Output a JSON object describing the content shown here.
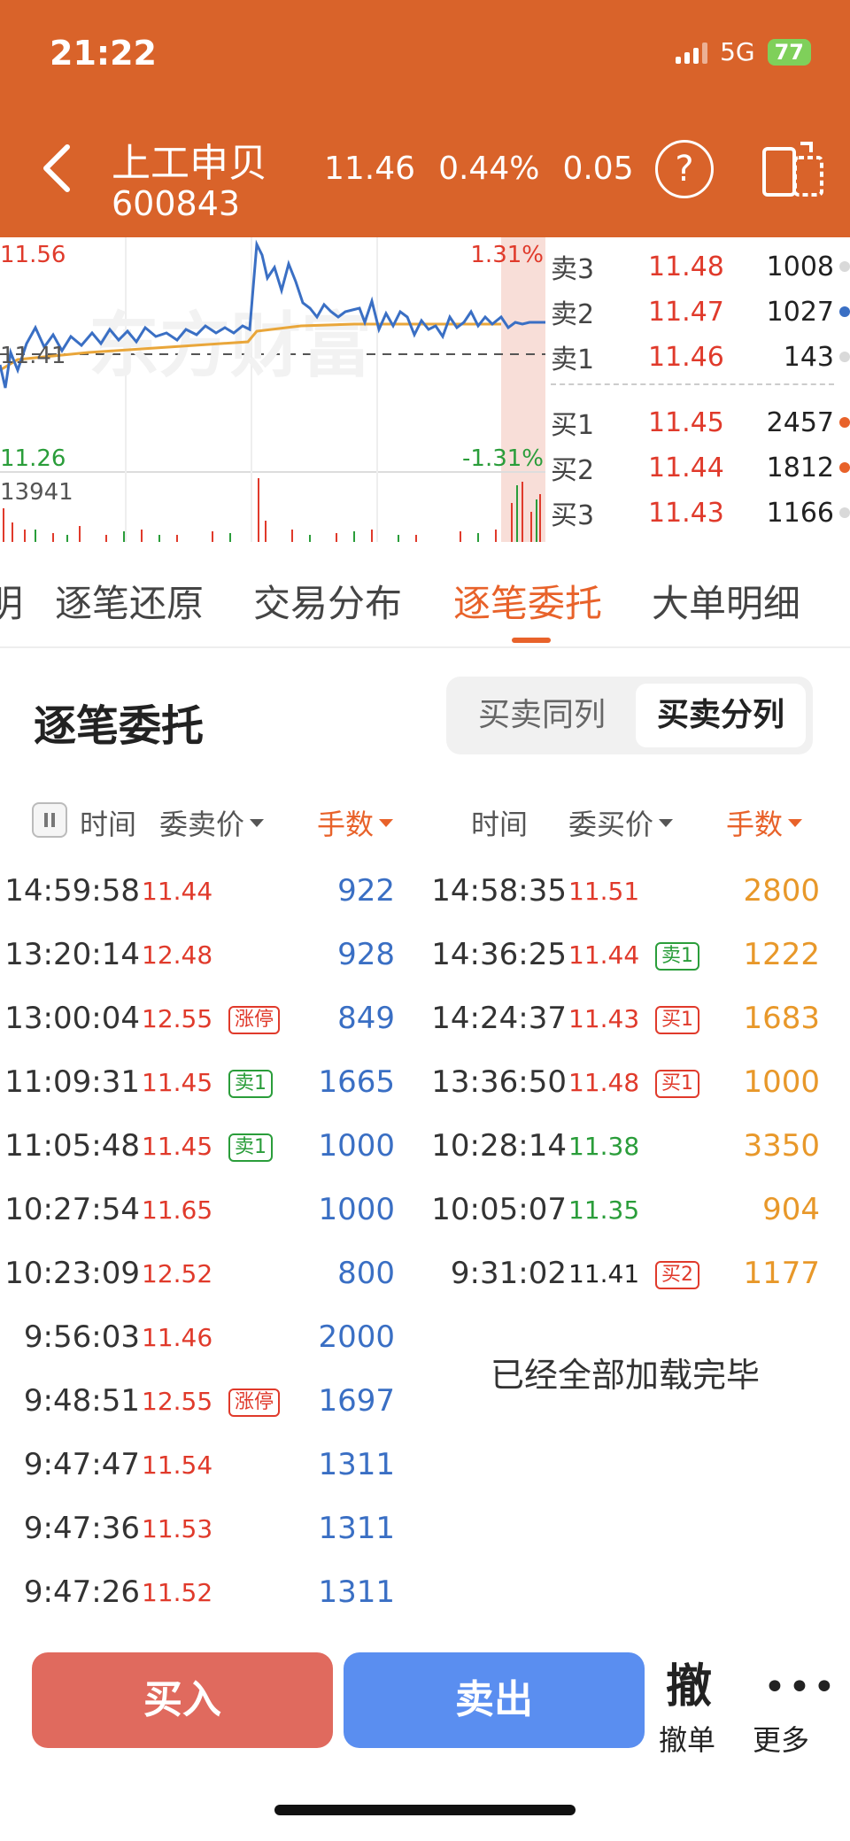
{
  "status": {
    "time": "21:22",
    "network": "5G",
    "battery": "77"
  },
  "header": {
    "name": "上工申贝",
    "code": "600843",
    "price": "11.46",
    "change_pct": "0.44%",
    "change": "0.05",
    "help": "?"
  },
  "chart": {
    "high": "11.56",
    "low": "11.26",
    "mid": "11.41",
    "high_pct": "1.31%",
    "low_pct": "-1.31%",
    "volume": "13941",
    "watermark": "东方财富"
  },
  "depth": {
    "sell": [
      {
        "label": "卖3",
        "price": "11.48",
        "vol": "1008",
        "dot": "#d9d9d9"
      },
      {
        "label": "卖2",
        "price": "11.47",
        "vol": "1027",
        "dot": "#3a6fc4"
      },
      {
        "label": "卖1",
        "price": "11.46",
        "vol": "143",
        "dot": "#d9d9d9"
      }
    ],
    "buy": [
      {
        "label": "买1",
        "price": "11.45",
        "vol": "2457",
        "dot": "#e8622a"
      },
      {
        "label": "买2",
        "price": "11.44",
        "vol": "1812",
        "dot": "#e8622a"
      },
      {
        "label": "买3",
        "price": "11.43",
        "vol": "1166",
        "dot": "#d9d9d9"
      }
    ]
  },
  "tabs": [
    "明",
    "逐笔还原",
    "交易分布",
    "逐笔委托",
    "大单明细"
  ],
  "section": {
    "title": "逐笔委托",
    "seg_same": "买卖同列",
    "seg_split": "买卖分列"
  },
  "columns": {
    "left": {
      "time": "时间",
      "price": "委卖价",
      "qty": "手数"
    },
    "right": {
      "time": "时间",
      "price": "委买价",
      "qty": "手数"
    }
  },
  "left_rows": [
    {
      "time": "14:59:58",
      "price": "11.44",
      "pc": "red",
      "badge": "",
      "bc": "",
      "qty": "922"
    },
    {
      "time": "13:20:14",
      "price": "12.48",
      "pc": "red",
      "badge": "",
      "bc": "",
      "qty": "928"
    },
    {
      "time": "13:00:04",
      "price": "12.55",
      "pc": "red",
      "badge": "涨停",
      "bc": "red",
      "qty": "849"
    },
    {
      "time": "11:09:31",
      "price": "11.45",
      "pc": "red",
      "badge": "卖1",
      "bc": "green",
      "qty": "1665"
    },
    {
      "time": "11:05:48",
      "price": "11.45",
      "pc": "red",
      "badge": "卖1",
      "bc": "green",
      "qty": "1000"
    },
    {
      "time": "10:27:54",
      "price": "11.65",
      "pc": "red",
      "badge": "",
      "bc": "",
      "qty": "1000"
    },
    {
      "time": "10:23:09",
      "price": "12.52",
      "pc": "red",
      "badge": "",
      "bc": "",
      "qty": "800"
    },
    {
      "time": "9:56:03",
      "price": "11.46",
      "pc": "red",
      "badge": "",
      "bc": "",
      "qty": "2000"
    },
    {
      "time": "9:48:51",
      "price": "12.55",
      "pc": "red",
      "badge": "涨停",
      "bc": "red",
      "qty": "1697"
    },
    {
      "time": "9:47:47",
      "price": "11.54",
      "pc": "red",
      "badge": "",
      "bc": "",
      "qty": "1311"
    },
    {
      "time": "9:47:36",
      "price": "11.53",
      "pc": "red",
      "badge": "",
      "bc": "",
      "qty": "1311"
    },
    {
      "time": "9:47:26",
      "price": "11.52",
      "pc": "red",
      "badge": "",
      "bc": "",
      "qty": "1311"
    }
  ],
  "right_rows": [
    {
      "time": "14:58:35",
      "price": "11.51",
      "pc": "red",
      "badge": "",
      "bc": "",
      "qty": "2800"
    },
    {
      "time": "14:36:25",
      "price": "11.44",
      "pc": "red",
      "badge": "卖1",
      "bc": "green",
      "qty": "1222"
    },
    {
      "time": "14:24:37",
      "price": "11.43",
      "pc": "red",
      "badge": "买1",
      "bc": "red",
      "qty": "1683"
    },
    {
      "time": "13:36:50",
      "price": "11.48",
      "pc": "red",
      "badge": "买1",
      "bc": "red",
      "qty": "1000"
    },
    {
      "time": "10:28:14",
      "price": "11.38",
      "pc": "green",
      "badge": "",
      "bc": "",
      "qty": "3350"
    },
    {
      "time": "10:05:07",
      "price": "11.35",
      "pc": "green",
      "badge": "",
      "bc": "",
      "qty": "904"
    },
    {
      "time": "9:31:02",
      "price": "11.41",
      "pc": "black",
      "badge": "买2",
      "bc": "red",
      "qty": "1177"
    }
  ],
  "loaded_text": "已经全部加载完毕",
  "bottom": {
    "buy": "买入",
    "sell": "卖出",
    "cancel_big": "撤",
    "cancel": "撤单",
    "more": "更多",
    "more_icon": "•••"
  },
  "colors": {
    "header": "#d9632a",
    "accent": "#e8622a",
    "buy": "#e06a5e",
    "sell": "#5a8ef0"
  }
}
